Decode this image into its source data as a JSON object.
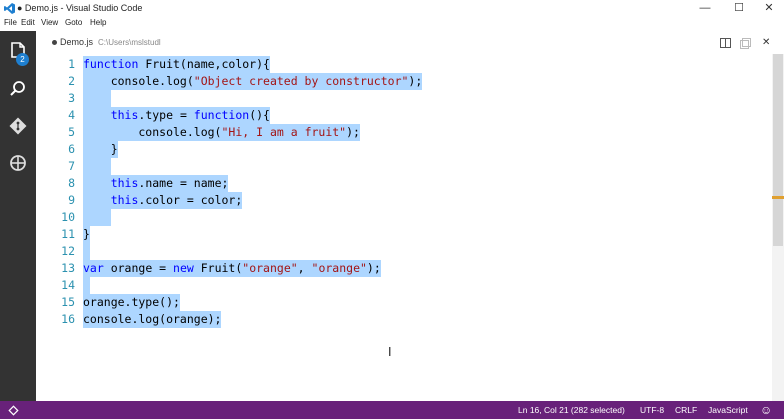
{
  "window": {
    "title": "● Demo.js - Visual Studio Code",
    "minimize": "—",
    "maximize": "☐",
    "close": "✕"
  },
  "menu": [
    "File",
    "Edit",
    "View",
    "Goto",
    "Help"
  ],
  "activity": {
    "icons": [
      "files-icon",
      "search-icon",
      "git-icon",
      "debug-icon"
    ],
    "badge": "2"
  },
  "tab": {
    "name": "Demo.js",
    "path": "C:\\Users\\mslstudl"
  },
  "editor_actions": {
    "split": "◫",
    "close": "✕"
  },
  "code": {
    "line_numbers": [
      "1",
      "2",
      "3",
      "4",
      "5",
      "6",
      "7",
      "8",
      "9",
      "10",
      "11",
      "12",
      "13",
      "14",
      "15",
      "16"
    ],
    "lines": [
      [
        [
          "k",
          "function"
        ],
        [
          "t",
          " Fruit(name,color){"
        ]
      ],
      [
        [
          "t",
          "    console.log("
        ],
        [
          "s",
          "\"Object created by constructor\""
        ],
        [
          "t",
          ");"
        ]
      ],
      [
        [
          "t",
          "    "
        ]
      ],
      [
        [
          "t",
          "    "
        ],
        [
          "k",
          "this"
        ],
        [
          "t",
          ".type = "
        ],
        [
          "k",
          "function"
        ],
        [
          "t",
          "(){"
        ]
      ],
      [
        [
          "t",
          "        console.log("
        ],
        [
          "s",
          "\"Hi, I am a fruit\""
        ],
        [
          "t",
          ");"
        ]
      ],
      [
        [
          "t",
          "    }"
        ]
      ],
      [
        [
          "t",
          "    "
        ]
      ],
      [
        [
          "t",
          "    "
        ],
        [
          "k",
          "this"
        ],
        [
          "t",
          ".name = name;"
        ]
      ],
      [
        [
          "t",
          "    "
        ],
        [
          "k",
          "this"
        ],
        [
          "t",
          ".color = color;"
        ]
      ],
      [
        [
          "t",
          "    "
        ]
      ],
      [
        [
          "t",
          "}"
        ]
      ],
      [
        [
          "t",
          " "
        ]
      ],
      [
        [
          "k",
          "var"
        ],
        [
          "t",
          " orange = "
        ],
        [
          "k",
          "new"
        ],
        [
          "t",
          " Fruit("
        ],
        [
          "s",
          "\"orange\""
        ],
        [
          "t",
          ", "
        ],
        [
          "s",
          "\"orange\""
        ],
        [
          "t",
          ");"
        ]
      ],
      [
        [
          "t",
          " "
        ]
      ],
      [
        [
          "t",
          "orange.type();"
        ]
      ],
      [
        [
          "t",
          "console.log(orange);"
        ]
      ]
    ]
  },
  "status": {
    "position": "Ln 16, Col 21 (282 selected)",
    "encoding": "UTF-8",
    "eol": "CRLF",
    "language": "JavaScript",
    "feedback": "☺"
  },
  "colors": {
    "statusbar": "#68217a",
    "activitybar": "#333333",
    "selection": "#add6ff",
    "keyword": "#0000ff",
    "string": "#a31515",
    "line_number": "#2b91af"
  }
}
